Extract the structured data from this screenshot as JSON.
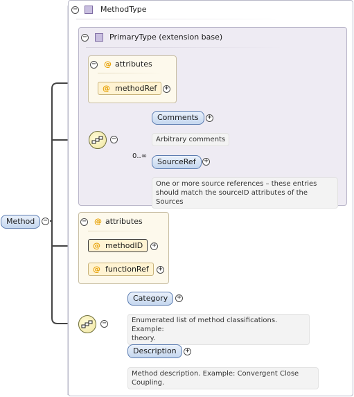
{
  "root": {
    "name": "Method",
    "toggle": "−"
  },
  "method_type": {
    "name": "MethodType",
    "toggle": "−",
    "icon": "complex-type-icon"
  },
  "primary_type": {
    "name": "PrimaryType (extension base)",
    "toggle": "−",
    "icon": "complex-type-icon"
  },
  "attrs1": {
    "title": "attributes",
    "toggle": "−",
    "at": "@",
    "items": [
      {
        "name": "methodRef",
        "plus": "+",
        "at": "@"
      }
    ]
  },
  "seq1": {
    "toggle": "−",
    "occurrence": "0..∞",
    "items": [
      {
        "name": "Comments",
        "plus": "+",
        "doc": "Arbitrary comments"
      },
      {
        "name": "SourceRef",
        "plus": "+",
        "doc_lines": [
          "One or more source references – these entries",
          "should match the sourceID attributes of the Sources"
        ]
      }
    ]
  },
  "attrs2": {
    "title": "attributes",
    "toggle": "−",
    "at": "@",
    "items": [
      {
        "name": "methodID",
        "plus": "+",
        "at": "@"
      },
      {
        "name": "functionRef",
        "plus": "+",
        "at": "@"
      }
    ]
  },
  "seq2": {
    "toggle": "−",
    "items": [
      {
        "name": "Category",
        "plus": "+",
        "doc_lines": [
          "Enumerated list of method classifications. Example:",
          "theory."
        ]
      },
      {
        "name": "Description",
        "plus": "+",
        "doc_lines": [
          "Method description. Example: Convergent Close",
          "Coupling."
        ]
      }
    ]
  }
}
